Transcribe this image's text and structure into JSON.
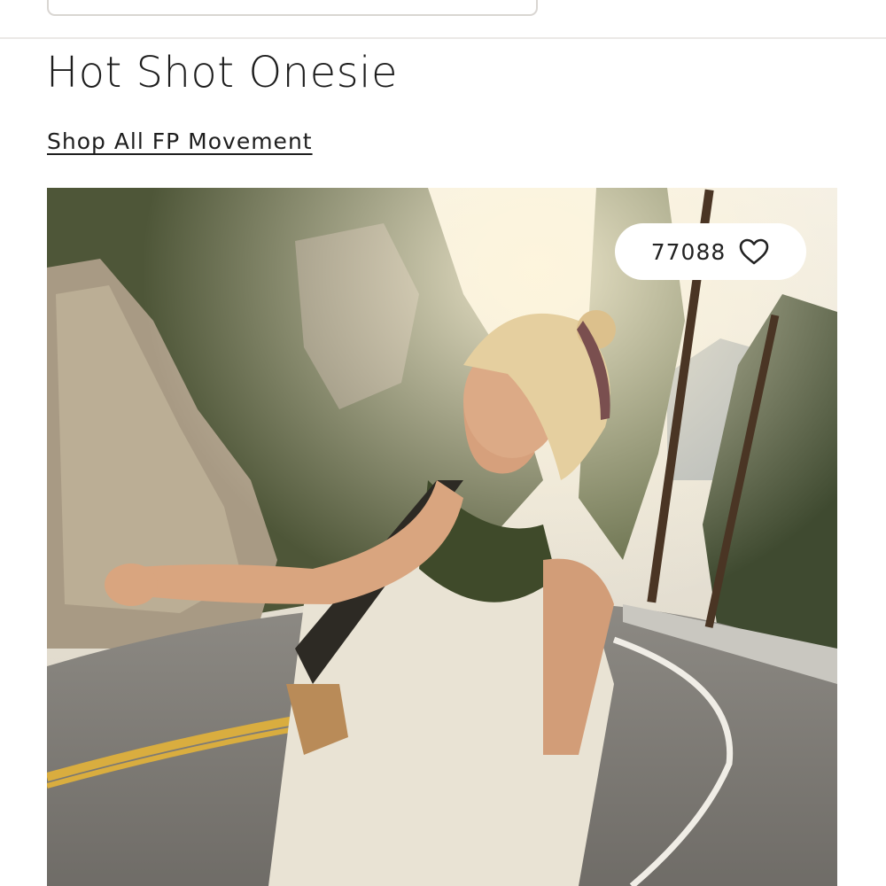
{
  "header": {
    "search_placeholder": ""
  },
  "product": {
    "title": "Hot Shot Onesie",
    "collection_link": "Shop All FP Movement",
    "image_alt": "Smiling woman wearing cream onesie hitchhiking on a mountain road",
    "like_count": "77088",
    "like_icon": "heart-outline-icon"
  },
  "colors": {
    "text": "#1e1e1e",
    "divider": "#ebe9e6",
    "pill_bg": "#ffffff"
  }
}
